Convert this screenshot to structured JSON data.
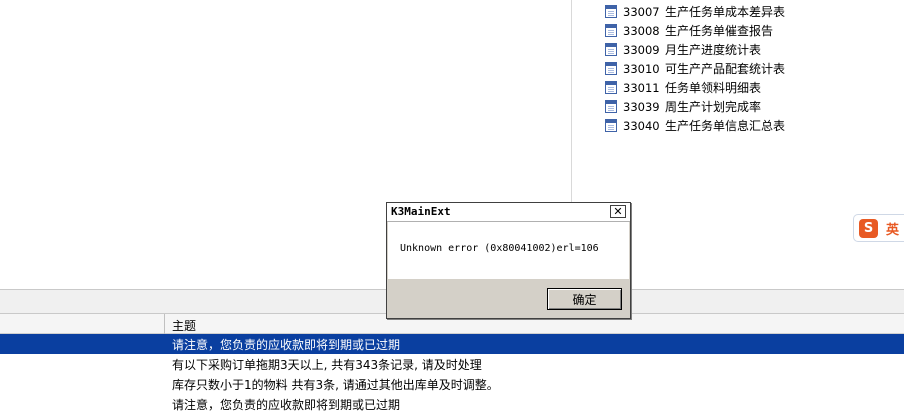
{
  "reports": [
    {
      "code": "33007",
      "name": "生产任务单成本差异表"
    },
    {
      "code": "33008",
      "name": "生产任务单催查报告"
    },
    {
      "code": "33009",
      "name": "月生产进度统计表"
    },
    {
      "code": "33010",
      "name": "可生产产品配套统计表"
    },
    {
      "code": "33011",
      "name": "任务单领料明细表"
    },
    {
      "code": "33039",
      "name": "周生产计划完成率"
    },
    {
      "code": "33040",
      "name": "生产任务单信息汇总表"
    }
  ],
  "ime": {
    "logo": "S",
    "lang": "英"
  },
  "messages": {
    "column_header": "主题",
    "rows": [
      {
        "text": "请注意，您负责的应收款即将到期或已过期",
        "selected": true
      },
      {
        "text": "有以下采购订单拖期3天以上, 共有343条记录, 请及时处理",
        "selected": false
      },
      {
        "text": "库存只数小于1的物料 共有3条, 请通过其他出库单及时调整。",
        "selected": false
      },
      {
        "text": "请注意，您负责的应收款即将到期或已过期",
        "selected": false
      }
    ]
  },
  "dialog": {
    "title": "K3MainExt",
    "close_glyph": "✕",
    "message": "Unknown error (0x80041002)erl=106",
    "ok_label": "确定"
  },
  "colors": {
    "selection": "#0a3fa0",
    "dialog_face": "#d4d0c8",
    "ime_brand": "#e85a24"
  }
}
